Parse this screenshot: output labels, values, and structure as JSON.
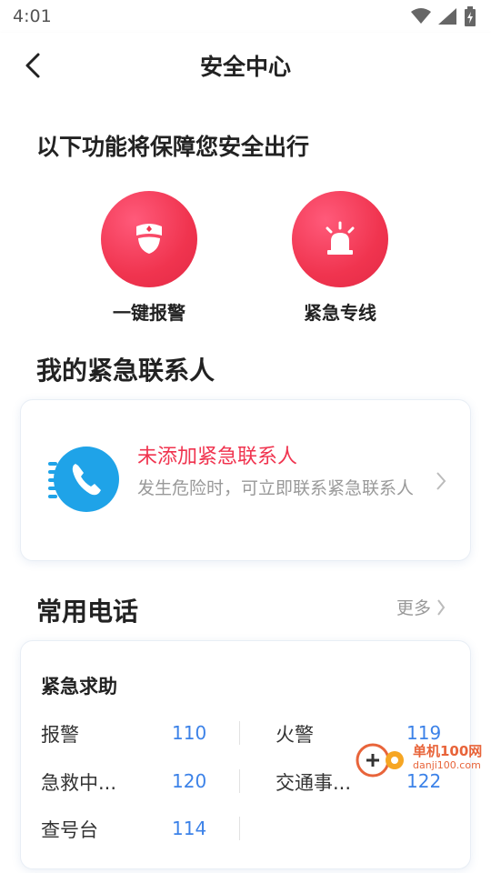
{
  "status_bar": {
    "time": "4:01"
  },
  "nav": {
    "title": "安全中心"
  },
  "intro": {
    "heading": "以下功能将保障您安全出行"
  },
  "features": [
    {
      "label": "一键报警",
      "icon": "police-cap-icon"
    },
    {
      "label": "紧急专线",
      "icon": "alarm-light-icon"
    }
  ],
  "contacts": {
    "heading": "我的紧急联系人",
    "empty_title": "未添加紧急联系人",
    "empty_desc": "发生危险时，可立即联系紧急联系人"
  },
  "phones": {
    "heading": "常用电话",
    "more_label": "更多",
    "card_title": "紧急求助",
    "items": [
      {
        "name": "报警",
        "number": "110"
      },
      {
        "name": "火警",
        "number": "119"
      },
      {
        "name": "急救中...",
        "number": "120"
      },
      {
        "name": "交通事...",
        "number": "122"
      },
      {
        "name": "查号台",
        "number": "114"
      }
    ]
  },
  "watermark": {
    "cn": "单机100网",
    "en": "danji100.com"
  },
  "colors": {
    "accent_red": "#f0344f",
    "link_blue": "#3c82e8",
    "icon_blue": "#1fa3e8"
  }
}
